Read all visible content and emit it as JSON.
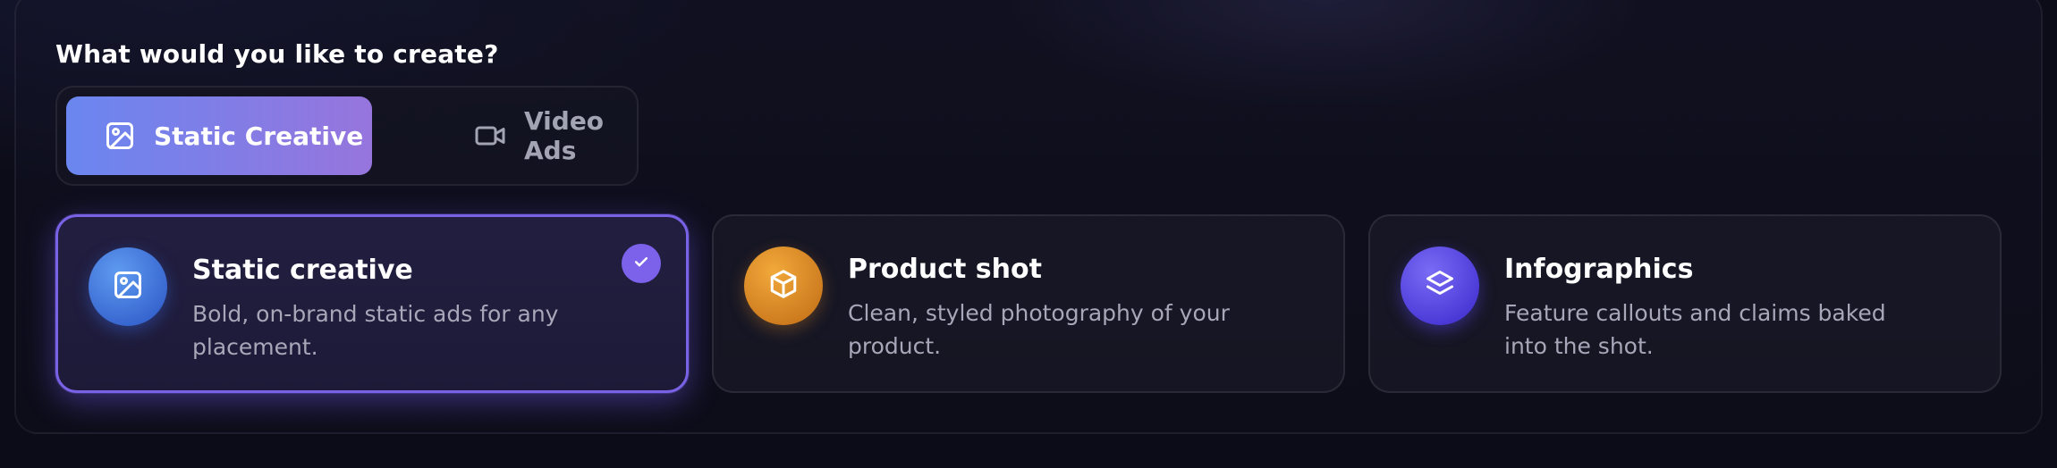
{
  "prompt": {
    "heading": "What would you like to create?"
  },
  "mode_toggle": {
    "options": [
      {
        "label": "Static Creative",
        "icon": "image-icon",
        "selected": true
      },
      {
        "label": "Video Ads",
        "icon": "video-camera-icon",
        "selected": false
      }
    ]
  },
  "creative_types": [
    {
      "title": "Static creative",
      "description": "Bold, on-brand static ads for any placement.",
      "icon": "image-icon",
      "icon_color": "#4a7fe0",
      "selected": true
    },
    {
      "title": "Product shot",
      "description": "Clean, styled photography of your product.",
      "icon": "box-icon",
      "icon_color": "#e0922c",
      "selected": false
    },
    {
      "title": "Infographics",
      "description": "Feature callouts and claims baked into the shot.",
      "icon": "layers-icon",
      "icon_color": "#5b49e6",
      "selected": false
    }
  ],
  "colors": {
    "accent": "#7c62ea",
    "toggle_gradient_start": "#6b86f0",
    "toggle_gradient_end": "#9675dd",
    "background": "#0c0c18"
  }
}
